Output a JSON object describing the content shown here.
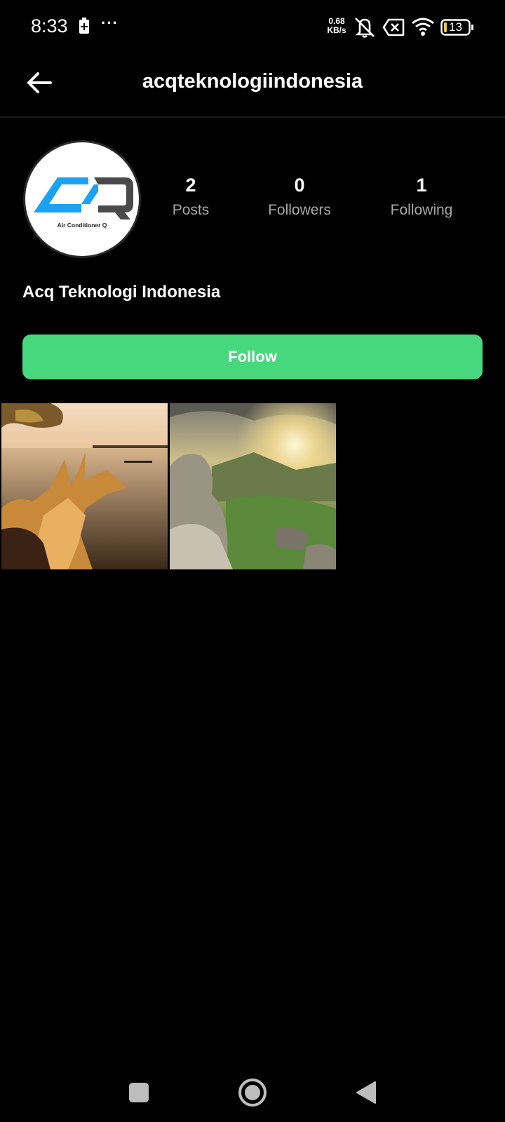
{
  "status_bar": {
    "time": "8:33",
    "more_glyph": "···",
    "net_speed_value": "0.68",
    "net_speed_unit": "KB/s",
    "battery_level": "13",
    "icons": [
      "battery-saver-icon",
      "more-icon",
      "mute-icon",
      "no-sim-icon",
      "wifi-icon",
      "battery-icon"
    ]
  },
  "header": {
    "title": "acqteknologiindonesia",
    "back_icon": "arrow-left-icon"
  },
  "profile": {
    "avatar_caption": "Air Conditioner Q",
    "stats": [
      {
        "value": "2",
        "label": "Posts"
      },
      {
        "value": "0",
        "label": "Followers"
      },
      {
        "value": "1",
        "label": "Following"
      }
    ],
    "display_name": "Acq Teknologi Indonesia",
    "follow_label": "Follow"
  },
  "colors": {
    "background": "#000000",
    "accent_follow": "#47d87e",
    "logo_blue": "#1aa3f5",
    "logo_gray": "#555555",
    "muted_text": "#a8a8a8"
  },
  "posts": [
    {
      "subject": "tree-by-lake-sunset"
    },
    {
      "subject": "mountain-sunrise"
    }
  ],
  "nav_bar": {
    "icons": [
      "recents-square-icon",
      "home-circle-icon",
      "back-triangle-icon"
    ]
  }
}
